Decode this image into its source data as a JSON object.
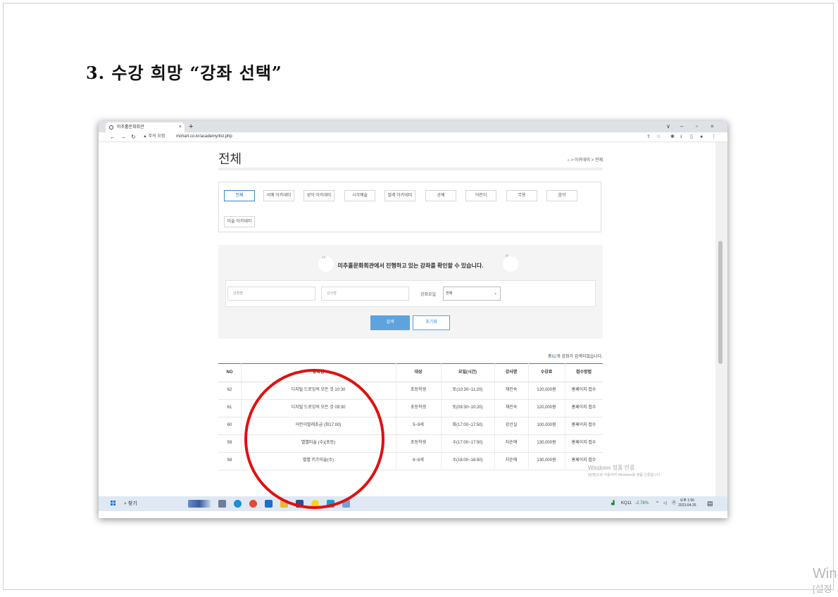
{
  "doc": {
    "heading": "3. 수강 희망 “강좌 선택”",
    "corner_watermark_1": "Win",
    "corner_watermark_2": "[설정"
  },
  "browser": {
    "tab_title": "미추홀문화회관",
    "tab_close": "×",
    "new_tab": "+",
    "win_controls": [
      "∨",
      "–",
      "▫",
      "×"
    ],
    "security_warning": "▲ 주의 요함",
    "url": "mchart.co.kr/academy/list.php"
  },
  "page": {
    "title": "전체",
    "breadcrumb": "⌂ > 아카데미 > 전체",
    "categories": [
      "전체",
      "서예 아카데미",
      "성악 아카데미",
      "시각예술",
      "발레 아카데미",
      "공예",
      "어린이",
      "무용",
      "음악",
      "미술 아카데미"
    ],
    "active_category": "전체",
    "search_message": "미추홀문화회관에서 진행하고 있는 강좌를 확인할 수 있습니다.",
    "course_placeholder": "강좌명",
    "instructor_placeholder": "강사명",
    "day_label": "강좌요일",
    "day_value": "전체",
    "search_button": "검색",
    "reset_button": "초기화",
    "count_prefix": "총",
    "count": "62",
    "count_suffix": "개 강좌가 검색되었습니다."
  },
  "table": {
    "headers": [
      "NO",
      "강좌명",
      "대상",
      "요일(시간)",
      "강사명",
      "수강료",
      "접수방법"
    ],
    "rows": [
      [
        "62",
        "디지털 드로잉의 모든 것 10:30",
        "초등학생",
        "토(10:30~11:20)",
        "채진숙",
        "120,000원",
        "홈페이지 접수"
      ],
      [
        "61",
        "디지털 드로잉의 모든 것 09:30",
        "초등학생",
        "토(09:30~10:20)",
        "채진숙",
        "120,000원",
        "홈페이지 접수"
      ],
      [
        "60",
        "어린이발레초급 (화17:00)",
        "5~9세",
        "화(17:00~17:50)",
        "강선실",
        "100,000원",
        "홈페이지 접수"
      ],
      [
        "59",
        "별별미술 (수)(초등)",
        "초등학생",
        "수(17:00~17:50)",
        "지순애",
        "130,000원",
        "홈페이지 접수"
      ],
      [
        "58",
        "별별 키즈미술(수)",
        "6~8세",
        "수(16:00~16:50)",
        "지순애",
        "130,000원",
        "홈페이지 접수"
      ]
    ]
  },
  "overlay": {
    "windows_activate_1": "Windows 정품 인증",
    "windows_activate_2": "[설정]으로 이동하여 Windows를 정품 인증합니다."
  },
  "taskbar": {
    "search": "찾기",
    "stock": "KQ11",
    "stock_change": "-2.78%",
    "clock_time": "오후 1:56",
    "clock_date": "2023-04-25"
  },
  "colors": {
    "accent": "#5ea3dd",
    "annotation": "#e01010"
  }
}
